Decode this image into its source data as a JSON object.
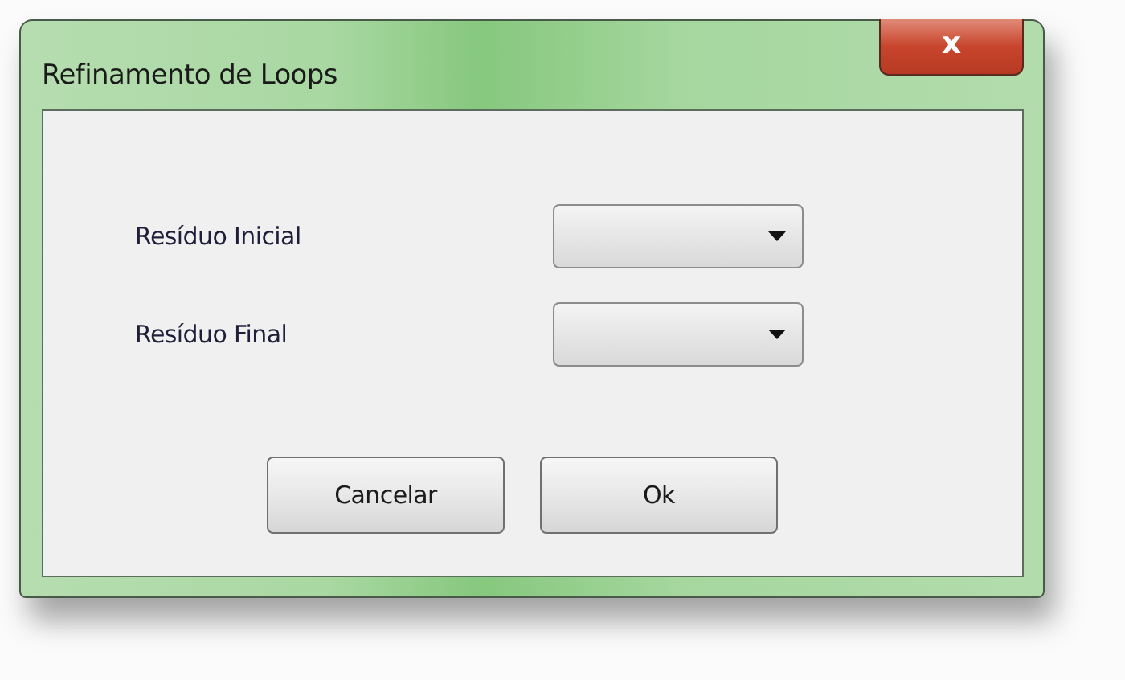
{
  "window": {
    "title": "Refinamento de Loops",
    "close": "x"
  },
  "fields": [
    {
      "label": "Resíduo Inicial"
    },
    {
      "label": "Resíduo Final"
    }
  ],
  "buttons": [
    "Cancelar",
    "Ok"
  ]
}
